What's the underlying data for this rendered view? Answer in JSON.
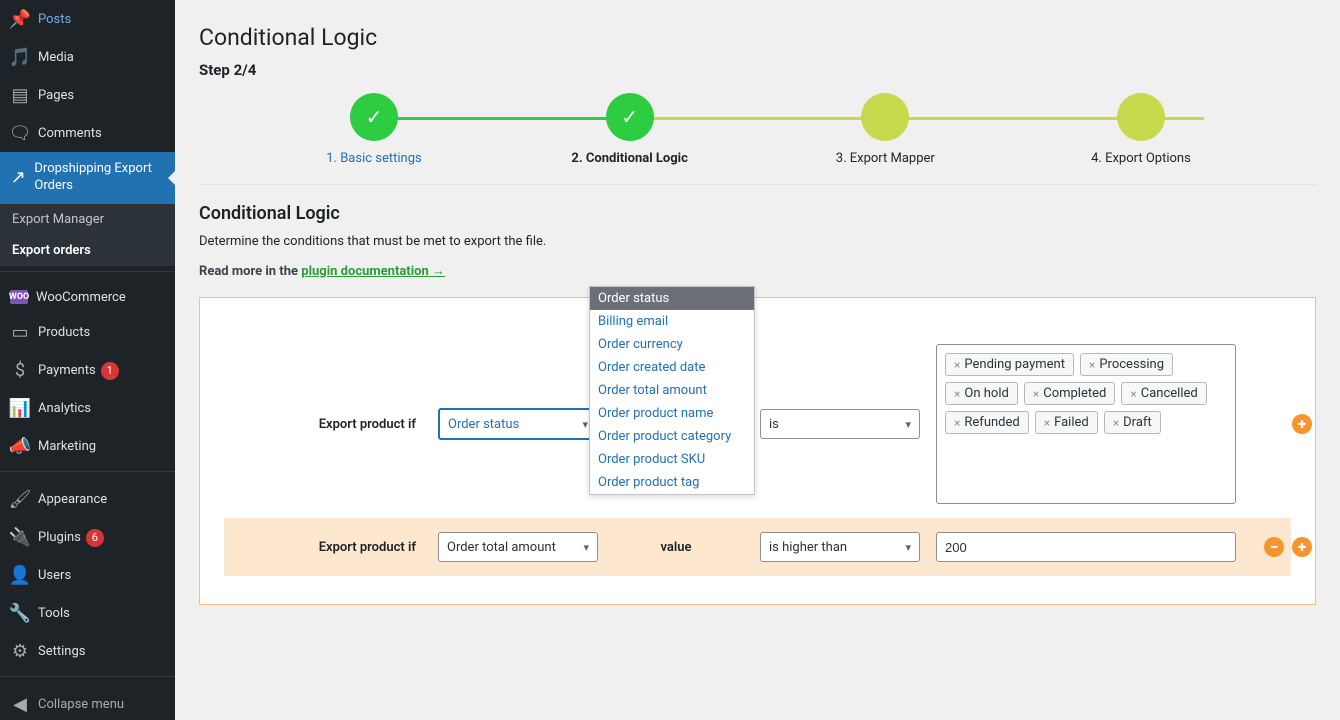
{
  "sidebar": {
    "items": [
      {
        "label": "Posts"
      },
      {
        "label": "Media"
      },
      {
        "label": "Pages"
      },
      {
        "label": "Comments"
      },
      {
        "label": "Dropshipping Export Orders"
      },
      {
        "label": "WooCommerce"
      },
      {
        "label": "Products"
      },
      {
        "label": "Payments",
        "badge": "1"
      },
      {
        "label": "Analytics"
      },
      {
        "label": "Marketing"
      },
      {
        "label": "Appearance"
      },
      {
        "label": "Plugins",
        "badge": "6"
      },
      {
        "label": "Users"
      },
      {
        "label": "Tools"
      },
      {
        "label": "Settings"
      }
    ],
    "submenu": {
      "items": [
        {
          "label": "Export Manager"
        },
        {
          "label": "Export orders"
        }
      ]
    },
    "collapse": "Collapse menu"
  },
  "page": {
    "title": "Conditional Logic",
    "step_prefix": "Step 2/4",
    "steps": [
      {
        "label": "1. Basic settings"
      },
      {
        "label": "2. Conditional Logic"
      },
      {
        "label": "3. Export Mapper"
      },
      {
        "label": "4. Export Options"
      }
    ]
  },
  "section": {
    "title": "Conditional Logic",
    "desc": "Determine the conditions that must be met to export the file.",
    "readmore_prefix": "Read more in the ",
    "readmore_link": "plugin documentation →"
  },
  "dropdown_options": [
    "Order status",
    "Billing email",
    "Order currency",
    "Order created date",
    "Order total amount",
    "Order product name",
    "Order product category",
    "Order product SKU",
    "Order product tag"
  ],
  "conditions": {
    "row_label": "Export product if",
    "value_label": "value",
    "rows": [
      {
        "field": "Order status",
        "op": "is",
        "tags": [
          "Pending payment",
          "Processing",
          "On hold",
          "Completed",
          "Cancelled",
          "Refunded",
          "Failed",
          "Draft"
        ]
      },
      {
        "field": "Order total amount",
        "op": "is higher than",
        "value": "200"
      }
    ]
  }
}
